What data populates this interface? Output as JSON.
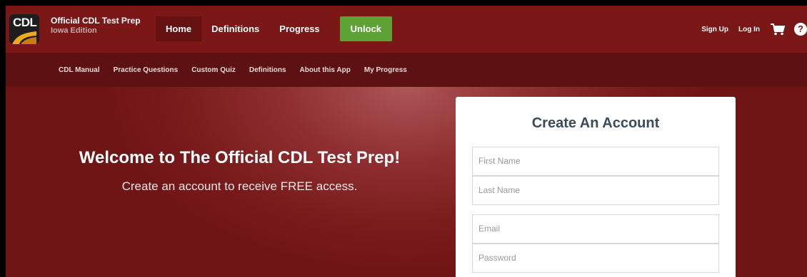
{
  "brand": {
    "title": "Official CDL Test Prep",
    "subtitle": "Iowa Edition",
    "logo_text": "CDL"
  },
  "nav": {
    "items": [
      "Home",
      "Definitions",
      "Progress"
    ],
    "unlock": "Unlock"
  },
  "account": {
    "signup": "Sign Up",
    "login": "Log In",
    "help": "?"
  },
  "subnav": [
    "CDL Manual",
    "Practice Questions",
    "Custom Quiz",
    "Definitions",
    "About this App",
    "My Progress"
  ],
  "hero": {
    "welcome": "Welcome to The Official CDL Test Prep!",
    "tagline": "Create an account to receive FREE access."
  },
  "form": {
    "title": "Create An Account",
    "first_name": "First Name",
    "last_name": "Last Name",
    "email": "Email",
    "password": "Password"
  },
  "colors": {
    "header": "#7c1718",
    "subnav": "#5e1113",
    "unlock": "#5ea235",
    "form_title": "#3b4a58"
  }
}
